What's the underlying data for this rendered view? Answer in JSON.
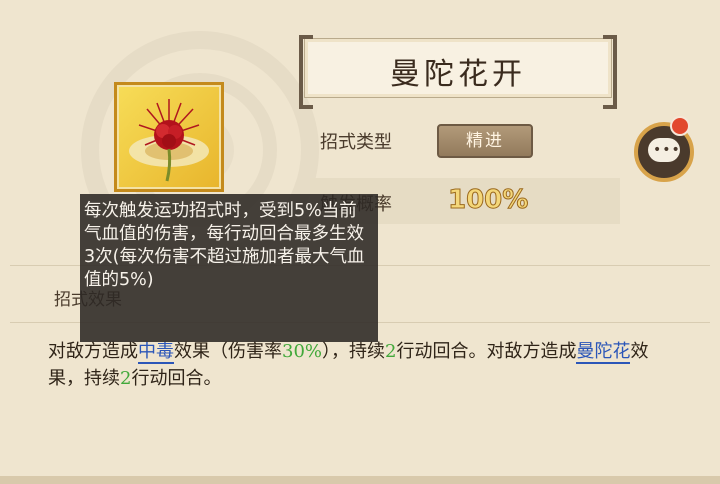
{
  "skill": {
    "name": "曼陀花开",
    "type_label": "招式类型",
    "type_value": "精进",
    "trigger_label": "触发概率",
    "trigger_value": "100%",
    "description_label": "招式效果",
    "description": {
      "part1": "对敌方造成",
      "keyword1": "中毒",
      "part2": "效果（伤害率",
      "num1": "30%",
      "part3": "），持续",
      "num2": "2",
      "part4": "行动回合。对敌方造成",
      "keyword2": "曼陀花",
      "part5": "效果，持续",
      "num3": "2",
      "part6": "行动回合。"
    }
  },
  "tooltip": {
    "text": "每次触发运功招式时，受到5%当前气血值的伤害，每行动回合最多生效3次(每次伤害不超过施加者最大气血值的5%)"
  },
  "icons": {
    "skill_icon": "red-spider-lily-icon",
    "chat": "chat-bubble-icon"
  },
  "colors": {
    "keyword_blue": "#2b56b8",
    "number_green": "#41a83a",
    "badge_red_dot": "#e2482e"
  }
}
